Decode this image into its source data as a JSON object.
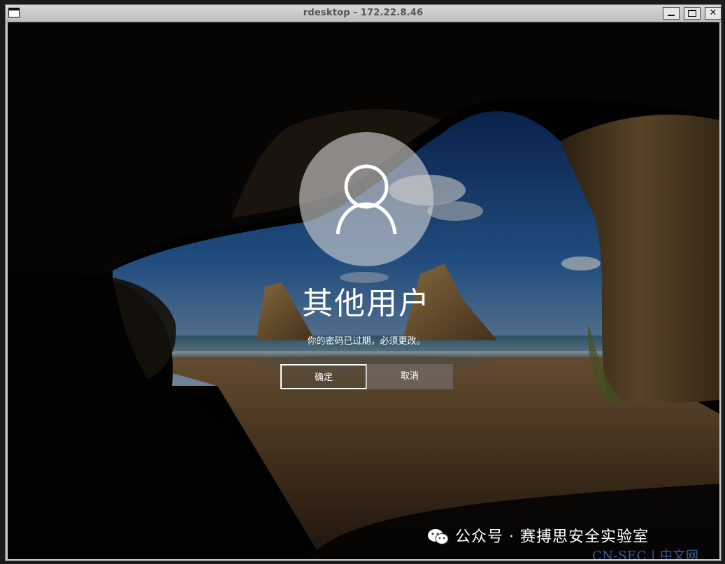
{
  "window": {
    "title": "rdesktop - 172.22.8.46",
    "buttons": {
      "minimize_icon": "minimize-icon",
      "maximize_icon": "maximize-icon",
      "close_icon": "close-icon"
    }
  },
  "lock_screen": {
    "username": "其他用户",
    "message": "你的密码已过期，必须更改。",
    "ok_label": "确定",
    "cancel_label": "取消",
    "avatar_icon": "user-icon"
  },
  "watermark": {
    "text": "公众号 · 赛搏思安全实验室",
    "site": "CN-SEC | 中文网"
  },
  "colors": {
    "titlebar": "#c8c8c8",
    "accent_white": "#ffffff",
    "cancel_button": "#7a7a7a"
  }
}
